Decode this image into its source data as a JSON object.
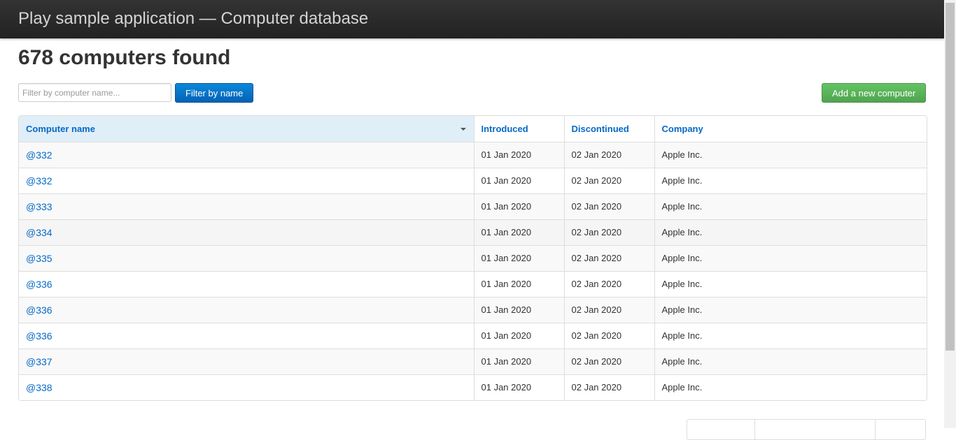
{
  "header": {
    "title": "Play sample application — Computer database"
  },
  "main": {
    "heading": "678 computers found",
    "filter": {
      "placeholder": "Filter by computer name...",
      "value": "",
      "button_label": "Filter by name"
    },
    "add_button_label": "Add a new computer"
  },
  "table": {
    "columns": [
      "Computer name",
      "Introduced",
      "Discontinued",
      "Company"
    ],
    "sorted_column": "Computer name",
    "rows": [
      {
        "name": "@332",
        "introduced": "01 Jan 2020",
        "discontinued": "02 Jan 2020",
        "company": "Apple Inc."
      },
      {
        "name": "@332",
        "introduced": "01 Jan 2020",
        "discontinued": "02 Jan 2020",
        "company": "Apple Inc."
      },
      {
        "name": "@333",
        "introduced": "01 Jan 2020",
        "discontinued": "02 Jan 2020",
        "company": "Apple Inc."
      },
      {
        "name": "@334",
        "introduced": "01 Jan 2020",
        "discontinued": "02 Jan 2020",
        "company": "Apple Inc."
      },
      {
        "name": "@335",
        "introduced": "01 Jan 2020",
        "discontinued": "02 Jan 2020",
        "company": "Apple Inc."
      },
      {
        "name": "@336",
        "introduced": "01 Jan 2020",
        "discontinued": "02 Jan 2020",
        "company": "Apple Inc."
      },
      {
        "name": "@336",
        "introduced": "01 Jan 2020",
        "discontinued": "02 Jan 2020",
        "company": "Apple Inc."
      },
      {
        "name": "@336",
        "introduced": "01 Jan 2020",
        "discontinued": "02 Jan 2020",
        "company": "Apple Inc."
      },
      {
        "name": "@337",
        "introduced": "01 Jan 2020",
        "discontinued": "02 Jan 2020",
        "company": "Apple Inc."
      },
      {
        "name": "@338",
        "introduced": "01 Jan 2020",
        "discontinued": "02 Jan 2020",
        "company": "Apple Inc."
      }
    ]
  },
  "colors": {
    "link": "#0569c7",
    "primary_button": "#0561b5",
    "success_button": "#51a351",
    "header_bar": "#222222",
    "sorted_header": "#e0eef7"
  }
}
